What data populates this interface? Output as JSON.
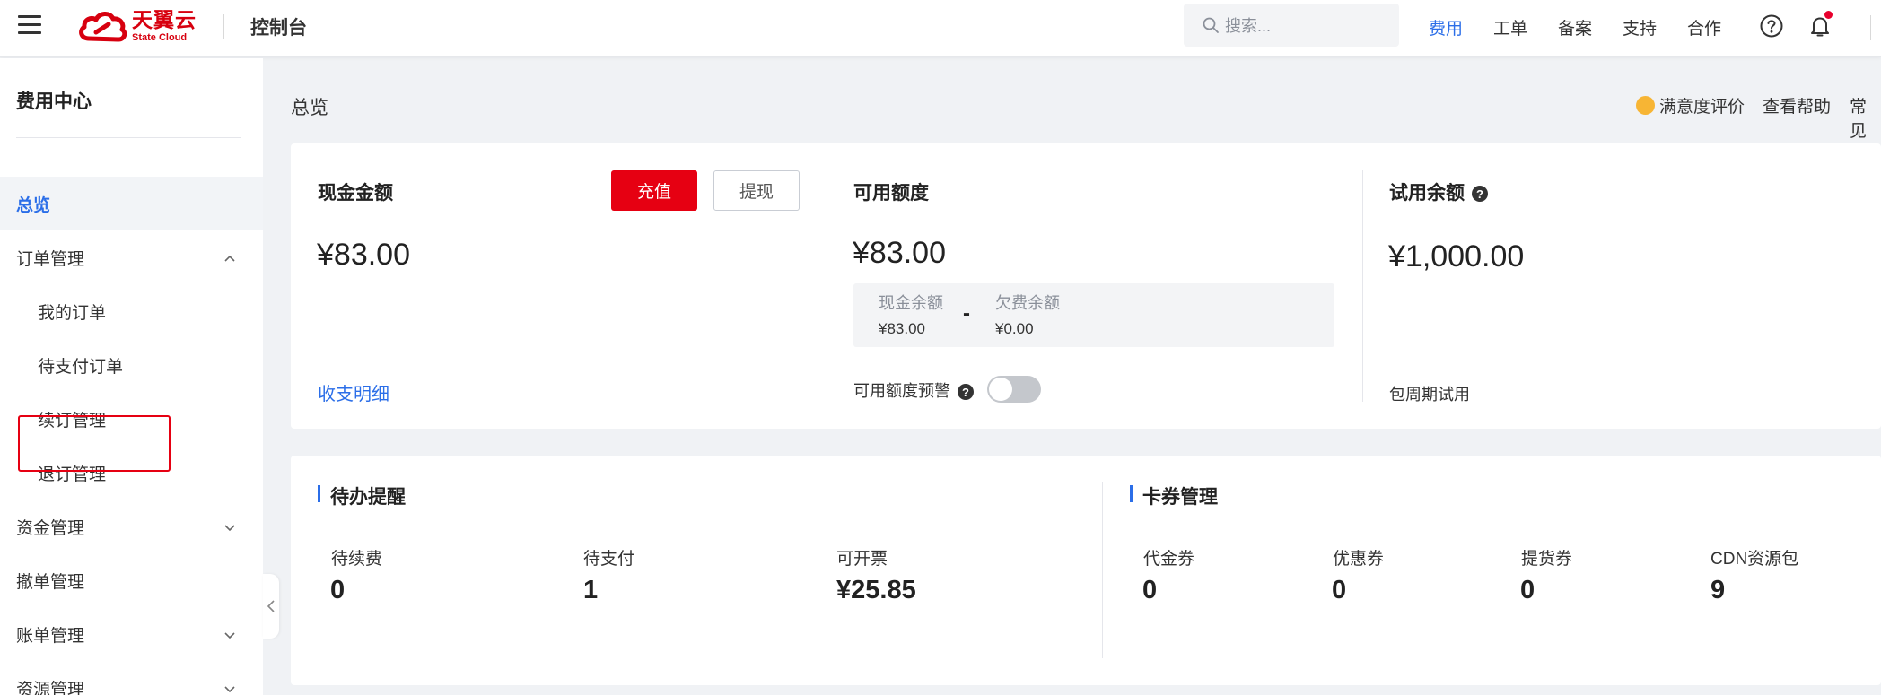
{
  "header": {
    "logo_cn": "天翼云",
    "logo_en": "State Cloud",
    "console_title": "控制台",
    "search_placeholder": "搜索...",
    "nav": [
      "费用",
      "工单",
      "备案",
      "支持",
      "合作"
    ],
    "active_nav": "费用",
    "accent_color": "#2b6ee8",
    "brand_color": "#e60012"
  },
  "sidebar": {
    "title": "费用中心",
    "items": [
      {
        "label": "总览",
        "active": true
      },
      {
        "label": "订单管理",
        "expanded": true
      },
      {
        "label": "我的订单"
      },
      {
        "label": "待支付订单"
      },
      {
        "label": "续订管理"
      },
      {
        "label": "退订管理",
        "highlighted": true
      },
      {
        "label": "资金管理",
        "expanded": false
      },
      {
        "label": "撤单管理"
      },
      {
        "label": "账单管理",
        "expanded": false
      },
      {
        "label": "资源管理",
        "expanded": false
      }
    ]
  },
  "page": {
    "breadcrumb": "总览",
    "top_links": [
      "满意度评价",
      "查看帮助",
      "常见"
    ]
  },
  "balance_card": {
    "cash": {
      "label": "现金金额",
      "amount": "¥83.00",
      "recharge": "充值",
      "withdraw": "提现",
      "detail_link": "收支明细"
    },
    "available": {
      "label": "可用额度",
      "amount": "¥83.00",
      "cash_balance_label": "现金余额",
      "cash_balance": "¥83.00",
      "minus": "-",
      "arrears_label": "欠费余额",
      "arrears": "¥0.00",
      "alert_label": "可用额度预警",
      "alert_on": false
    },
    "trial": {
      "label": "试用余额",
      "amount": "¥1,000.00",
      "sub_label": "包周期试用"
    }
  },
  "todo": {
    "title": "待办提醒",
    "items": [
      {
        "label": "待续费",
        "value": "0"
      },
      {
        "label": "待支付",
        "value": "1"
      },
      {
        "label": "可开票",
        "value": "¥25.85"
      }
    ]
  },
  "coupons": {
    "title": "卡券管理",
    "items": [
      {
        "label": "代金券",
        "value": "0"
      },
      {
        "label": "优惠券",
        "value": "0"
      },
      {
        "label": "提货券",
        "value": "0"
      },
      {
        "label": "CDN资源包",
        "value": "9"
      }
    ]
  }
}
